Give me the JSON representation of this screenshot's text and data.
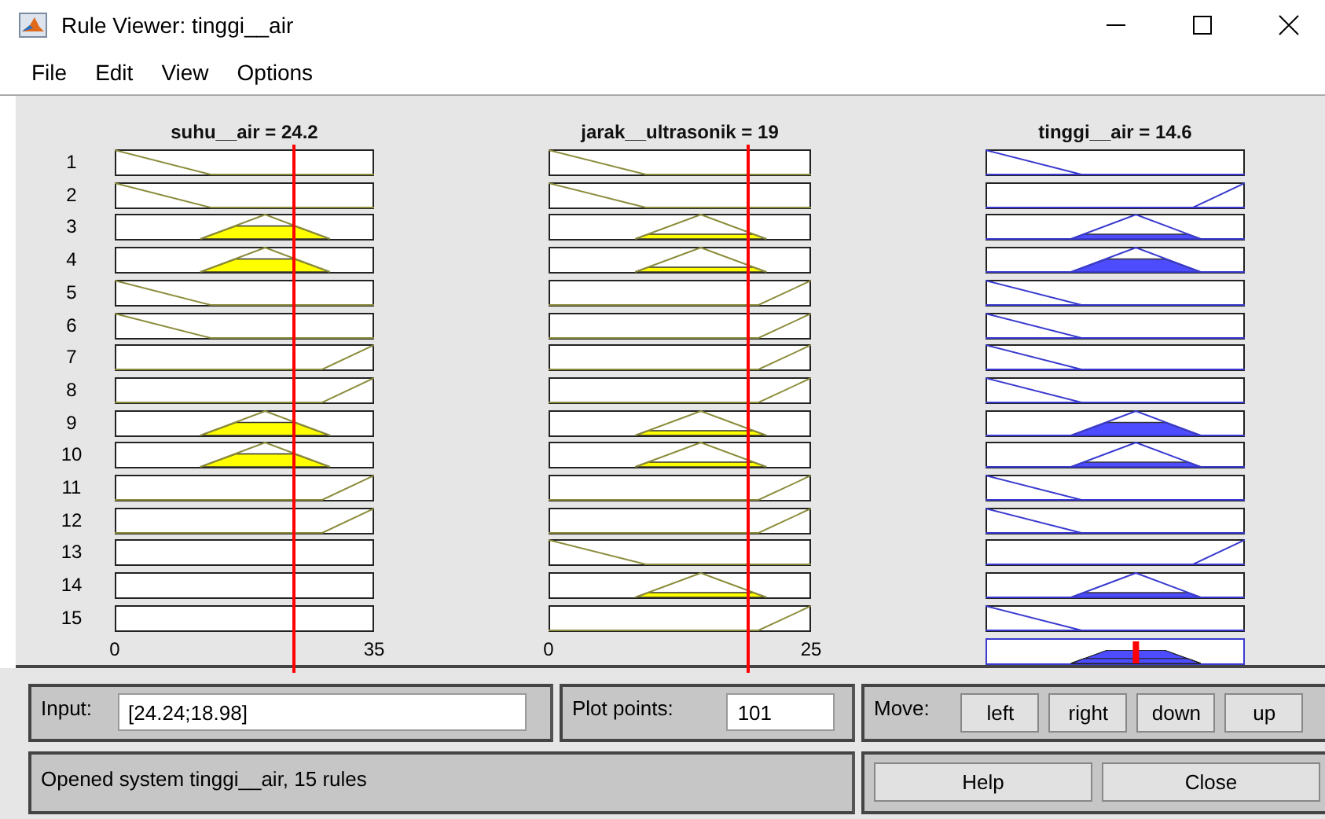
{
  "window": {
    "title": "Rule Viewer: tinggi__air"
  },
  "menu": [
    "File",
    "Edit",
    "View",
    "Options"
  ],
  "rule_numbers": [
    "1",
    "2",
    "3",
    "4",
    "5",
    "6",
    "7",
    "8",
    "9",
    "10",
    "11",
    "12",
    "13",
    "14",
    "15"
  ],
  "inputs": [
    {
      "label": "suhu__air = 24.2",
      "axis": [
        "0",
        "35"
      ],
      "rules": [
        {
          "kind": "down"
        },
        {
          "kind": "down"
        },
        {
          "kind": "trihigh"
        },
        {
          "kind": "trihigh"
        },
        {
          "kind": "down"
        },
        {
          "kind": "down"
        },
        {
          "kind": "up"
        },
        {
          "kind": "up"
        },
        {
          "kind": "trihigh"
        },
        {
          "kind": "trihigh"
        },
        {
          "kind": "up"
        },
        {
          "kind": "up"
        },
        {
          "kind": "none"
        },
        {
          "kind": "none"
        },
        {
          "kind": "none"
        }
      ]
    },
    {
      "label": "jarak__ultrasonik = 19",
      "axis": [
        "0",
        "25"
      ],
      "rules": [
        {
          "kind": "down"
        },
        {
          "kind": "down"
        },
        {
          "kind": "trilow"
        },
        {
          "kind": "trilow"
        },
        {
          "kind": "up"
        },
        {
          "kind": "up"
        },
        {
          "kind": "up"
        },
        {
          "kind": "up"
        },
        {
          "kind": "trilow"
        },
        {
          "kind": "trilow"
        },
        {
          "kind": "up"
        },
        {
          "kind": "up"
        },
        {
          "kind": "down"
        },
        {
          "kind": "trilow"
        },
        {
          "kind": "up"
        }
      ]
    }
  ],
  "output": {
    "label": "tinggi__air = 14.6",
    "level": 0.58,
    "rules": [
      {
        "kind": "down"
      },
      {
        "kind": "up"
      },
      {
        "kind": "trilow"
      },
      {
        "kind": "trihigh"
      },
      {
        "kind": "down"
      },
      {
        "kind": "down"
      },
      {
        "kind": "down"
      },
      {
        "kind": "down"
      },
      {
        "kind": "trihigh"
      },
      {
        "kind": "trilow"
      },
      {
        "kind": "down"
      },
      {
        "kind": "down"
      },
      {
        "kind": "up"
      },
      {
        "kind": "trilow"
      },
      {
        "kind": "down"
      }
    ]
  },
  "input_field": {
    "label": "Input:",
    "value": "[24.24;18.98]"
  },
  "plot_points": {
    "label": "Plot points:",
    "value": "101"
  },
  "move": {
    "label": "Move:",
    "buttons": [
      "left",
      "right",
      "down",
      "up"
    ]
  },
  "status": "Opened system tinggi__air, 15 rules",
  "buttons": [
    "Help",
    "Close"
  ]
}
